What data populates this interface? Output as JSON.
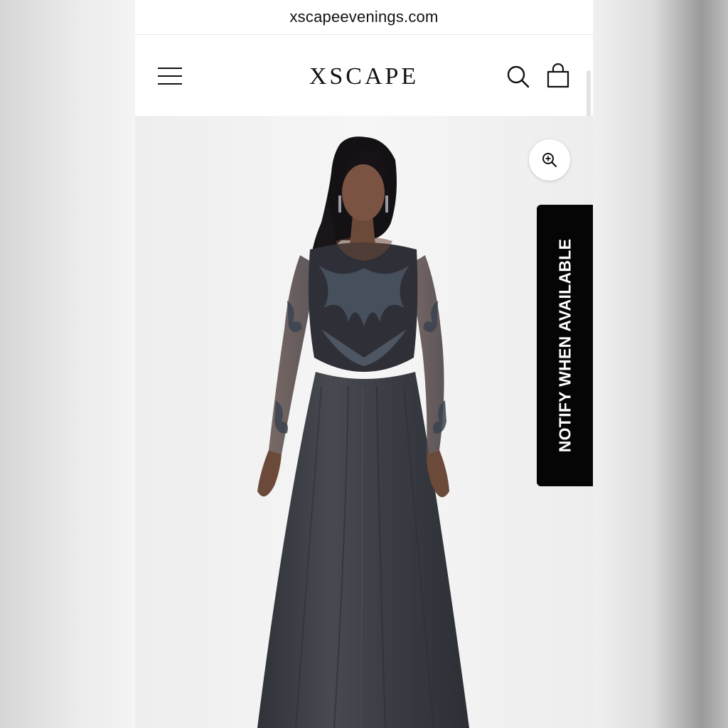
{
  "browser": {
    "url": "xscapeevenings.com"
  },
  "header": {
    "logo": "XSCAPE",
    "menu_icon": "hamburger-menu-icon",
    "search_icon": "search-icon",
    "cart_icon": "shopping-bag-icon"
  },
  "product": {
    "image_alt": "Model wearing long-sleeve beaded charcoal chiffon gown",
    "zoom_icon": "zoom-in-icon",
    "notify_label": "NOTIFY WHEN AVAILABLE"
  },
  "colors": {
    "page_bg": "#ffffff",
    "notify_bg": "#050505",
    "dress": "#3a3d44"
  }
}
